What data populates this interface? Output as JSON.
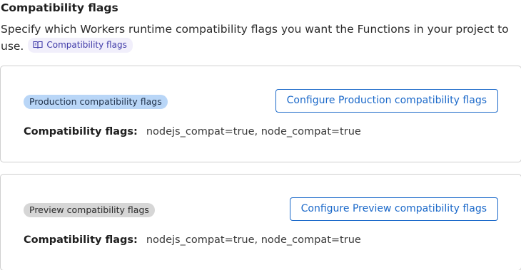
{
  "header": {
    "title": "Compatibility flags",
    "description": "Specify which Workers runtime compatibility flags you want the Functions in your project to use.",
    "doc_link_label": "Compatibility flags",
    "doc_link_icon": "book-icon"
  },
  "production": {
    "badge": "Production compatibility flags",
    "button_label": "Configure Production compatibility flags",
    "flags_label": "Compatibility flags:",
    "flags_value": "nodejs_compat=true, node_compat=true"
  },
  "preview": {
    "badge": "Preview compatibility flags",
    "button_label": "Configure Preview compatibility flags",
    "flags_label": "Compatibility flags:",
    "flags_value": "nodejs_compat=true, node_compat=true"
  },
  "colors": {
    "accent": "#1a68c9",
    "production_badge_bg": "#b9d6f7",
    "preview_badge_bg": "#d6d6d6",
    "doc_link_bg": "#f1effb",
    "doc_link_text": "#3f3aa8"
  }
}
